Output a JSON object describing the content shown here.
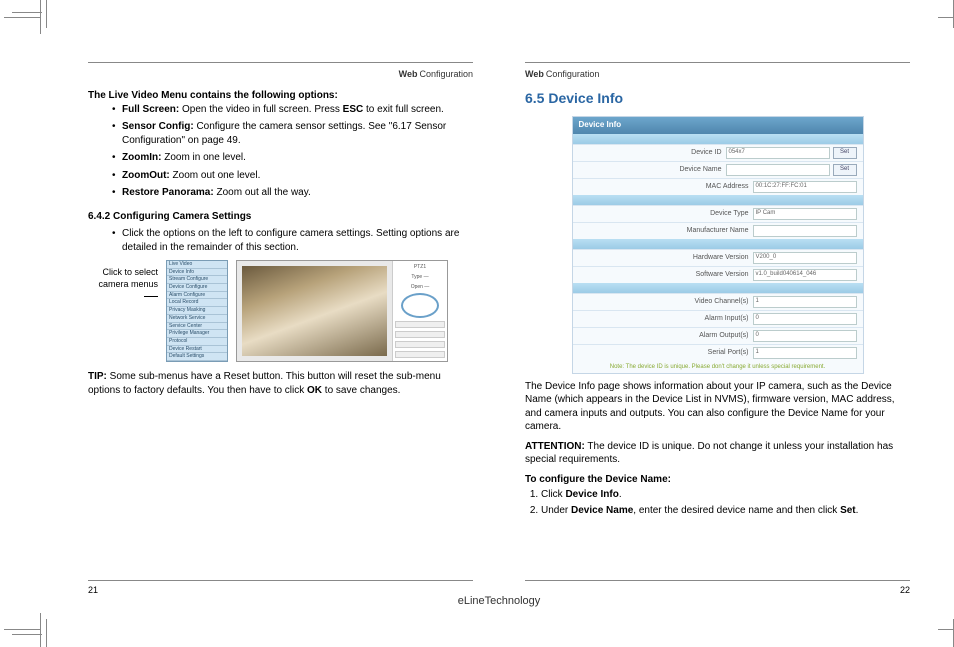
{
  "header": {
    "bold": "Web",
    "rest": "Configuration"
  },
  "left": {
    "intro": "The Live Video Menu contains the following options:",
    "items": [
      {
        "b": "Full Screen:",
        "t": " Open the video in full screen. Press ",
        "b2": "ESC",
        "t2": " to exit full screen."
      },
      {
        "b": "Sensor Config:",
        "t": " Configure the camera sensor settings. See \"6.17 Sensor Configuration\" on page 49."
      },
      {
        "b": "ZoomIn:",
        "t": " Zoom in one level."
      },
      {
        "b": "ZoomOut:",
        "t": " Zoom out one level."
      },
      {
        "b": "Restore Panorama:",
        "t": " Zoom out all the way."
      }
    ],
    "subsection": "6.4.2 Configuring Camera Settings",
    "sub_bullet": "Click the options on the left to configure camera settings. Setting options are detailed in the remainder of this section.",
    "caption": "Click to select camera menus",
    "menu_items": [
      "Live Video",
      "Device Info",
      "Stream Configure",
      "Device Configure",
      "Alarm Configure",
      "Local Record",
      "Privacy Masking",
      "Network Service",
      "Service Center",
      "Privilege Manager",
      "Protocol",
      "Device Restart",
      "Default Settings"
    ],
    "ss_top": {
      "a": "PTZ1",
      "b": "Type —",
      "c": "Open —"
    },
    "tip_b": "TIP:",
    "tip_t": " Some sub-menus have a Reset button. This button will reset the sub-menu options to factory defaults. You then have to click ",
    "tip_b2": "OK",
    "tip_t2": " to save changes.",
    "pagenum": "21"
  },
  "right": {
    "title": "6.5  Device Info",
    "panel_header": "Device Info",
    "rows_a": [
      {
        "l": "Device ID",
        "v": "054x7",
        "btn": "Set"
      },
      {
        "l": "Device Name",
        "v": "",
        "btn": "Set"
      },
      {
        "l": "MAC Address",
        "v": "00:1C:27:FF:FC:01",
        "btn": ""
      }
    ],
    "rows_b": [
      {
        "l": "Device Type",
        "v": "IP Cam"
      },
      {
        "l": "Manufacturer Name",
        "v": ""
      }
    ],
    "rows_c": [
      {
        "l": "Hardware Version",
        "v": "V200_0"
      },
      {
        "l": "Software Version",
        "v": "v1.0_build040614_046"
      }
    ],
    "rows_d": [
      {
        "l": "Video Channel(s)",
        "v": "1"
      },
      {
        "l": "Alarm Input(s)",
        "v": "0"
      },
      {
        "l": "Alarm Output(s)",
        "v": "0"
      },
      {
        "l": "Serial Port(s)",
        "v": "1"
      }
    ],
    "note": "Note: The device ID is unique. Please don't change it unless special requirement.",
    "para1": "The Device Info page shows information about your IP camera, such as the Device Name (which appears in the Device List in NVMS), firmware version, MAC address, and camera inputs and outputs. You can also configure the Device Name for your camera.",
    "att_b": "ATTENTION:",
    "att_t": " The device ID is unique. Do not change it unless your installation has special requirements.",
    "steps_title": "To configure the Device Name:",
    "steps": [
      {
        "pre": "Click ",
        "b": "Device Info",
        "post": "."
      },
      {
        "pre": "Under ",
        "b": "Device Name",
        "mid": ", enter the desired device name and then click ",
        "b2": "Set",
        "post": "."
      }
    ],
    "pagenum": "22"
  },
  "brand": "eLineTechnology"
}
